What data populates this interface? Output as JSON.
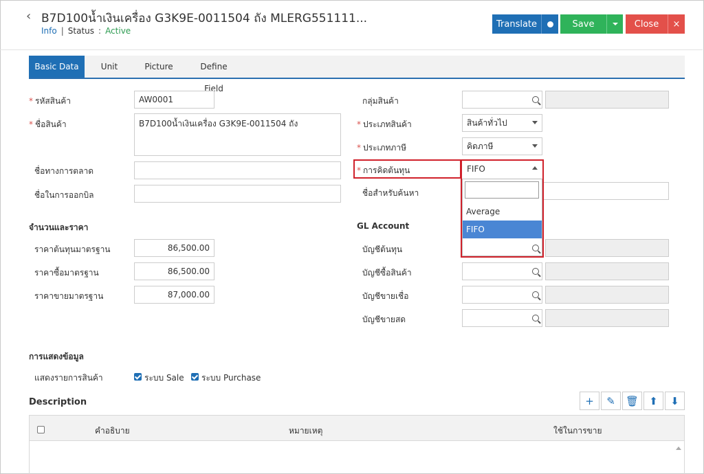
{
  "header": {
    "title": "B7D100น้ำเงินเครื่อง G3K9E-0011504 ถัง MLERG551111...",
    "info_label": "Info",
    "status_label": "Status",
    "status_value": "Active",
    "translate_label": "Translate",
    "save_label": "Save",
    "close_label": "Close",
    "close_x": "×"
  },
  "tabs": [
    {
      "label": "Basic Data",
      "active": true
    },
    {
      "label": "Unit",
      "active": false
    },
    {
      "label": "Picture",
      "active": false
    },
    {
      "label": "Define Field",
      "active": false
    }
  ],
  "left_form": {
    "code_label": "รหัสสินค้า",
    "code_value": "AW0001",
    "name_label": "ชื่อสินค้า",
    "name_value": "B7D100น้ำเงินเครื่อง G3K9E-0011504 ถัง",
    "marketing_name_label": "ชื่อทางการตลาด",
    "marketing_name_value": "",
    "billing_name_label": "ชื่อในการออกบิล",
    "billing_name_value": ""
  },
  "price_section": {
    "title": "จำนวนและราคา",
    "std_cost_label": "ราคาต้นทุนมาตรฐาน",
    "std_cost_value": "86,500.00",
    "std_buy_label": "ราคาซื้อมาตรฐาน",
    "std_buy_value": "86,500.00",
    "std_sell_label": "ราคาขายมาตรฐาน",
    "std_sell_value": "87,000.00"
  },
  "right_form": {
    "group_label": "กลุ่มสินค้า",
    "type_label": "ประเภทสินค้า",
    "type_value": "สินค้าทั่วไป",
    "tax_label": "ประเภทภาษี",
    "tax_value": "คิดภาษี",
    "costing_label": "การคิดต้นทุน",
    "costing_value": "FIFO",
    "search_name_label": "ชื่อสำหรับค้นหา"
  },
  "costing_dropdown": {
    "search_value": "",
    "options": [
      {
        "label": "Average",
        "selected": false
      },
      {
        "label": "FIFO",
        "selected": true
      }
    ]
  },
  "gl_section": {
    "title": "GL Account",
    "cost_account_label": "บัญชีต้นทุน",
    "purchase_account_label": "บัญชีซื้อสินค้า",
    "credit_sale_account_label": "บัญชีขายเชื่อ",
    "cash_sale_account_label": "บัญชีขายสด"
  },
  "display_section": {
    "title": "การแสดงข้อมูล",
    "show_items_label": "แสดงรายการสินค้า",
    "sale_label": "ระบบ Sale",
    "sale_checked": true,
    "purchase_label": "ระบบ Purchase",
    "purchase_checked": true
  },
  "description": {
    "title": "Description",
    "columns": [
      "คำอธิบาย",
      "หมายเหตุ",
      "ใช้ในการขาย"
    ]
  },
  "colors": {
    "primary": "#1f6fb5",
    "success": "#2fb35a",
    "danger": "#e3504a",
    "highlight": "#d0202a",
    "selected_option": "#4a86d4"
  }
}
